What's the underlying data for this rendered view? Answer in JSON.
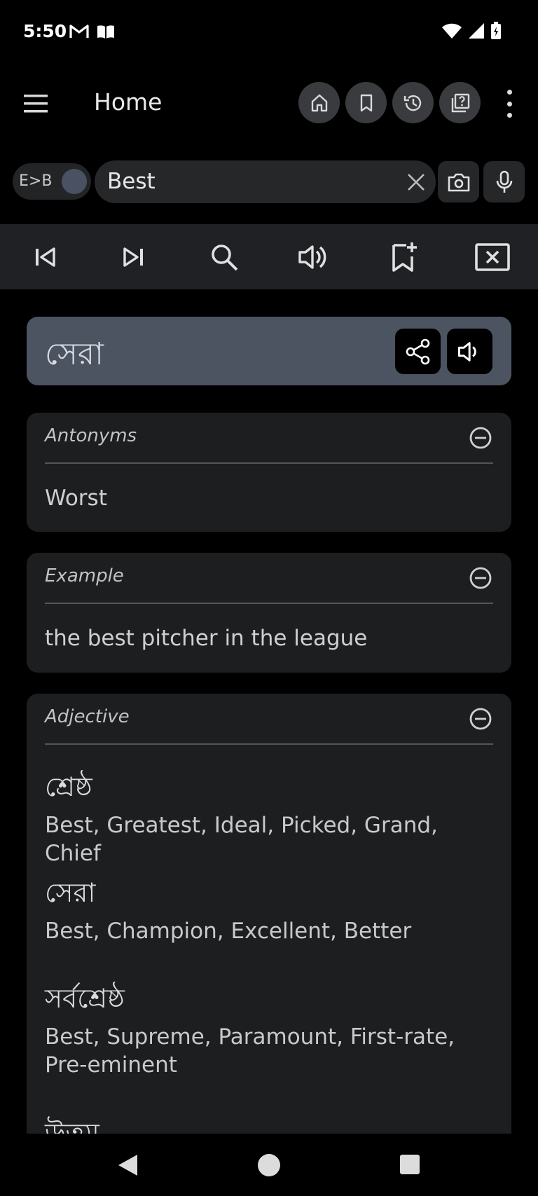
{
  "status_bar": {
    "time": "5:50",
    "left_icons": [
      "gmail-icon",
      "book-icon"
    ],
    "right_icons": [
      "wifi-icon",
      "signal-icon",
      "battery-charging-icon"
    ]
  },
  "app_bar": {
    "title": "Home",
    "actions": [
      "home-icon",
      "bookmark-icon",
      "history-icon",
      "quiz-icon"
    ],
    "overflow_icon": "more-vert-icon"
  },
  "search": {
    "lang_label": "E>B",
    "query": "Best"
  },
  "toolbar": {
    "items": [
      "skip-previous-icon",
      "skip-next-icon",
      "search-icon",
      "volume-icon",
      "bookmark-add-icon",
      "close-box-icon"
    ]
  },
  "translation": {
    "word": "সেরা"
  },
  "antonyms": {
    "header": "Antonyms",
    "text": "Worst"
  },
  "example": {
    "header": "Example",
    "text": "the best pitcher in the league"
  },
  "adjective": {
    "header": "Adjective",
    "entries": [
      {
        "word": "শ্রেষ্ঠ",
        "synonyms": "Best, Greatest, Ideal, Picked, Grand, Chief"
      },
      {
        "word": "সেরা",
        "synonyms": "Best, Champion, Excellent, Better"
      },
      {
        "word": "সর্বশ্রেষ্ঠ",
        "synonyms": "Best, Supreme, Paramount, First-rate, Pre-eminent"
      },
      {
        "word": "উত্তম",
        "synonyms": ""
      }
    ]
  },
  "colors": {
    "background": "#000000",
    "card": "#1d1e20",
    "translation_card": "#4c5361",
    "toolbar": "#202124"
  }
}
